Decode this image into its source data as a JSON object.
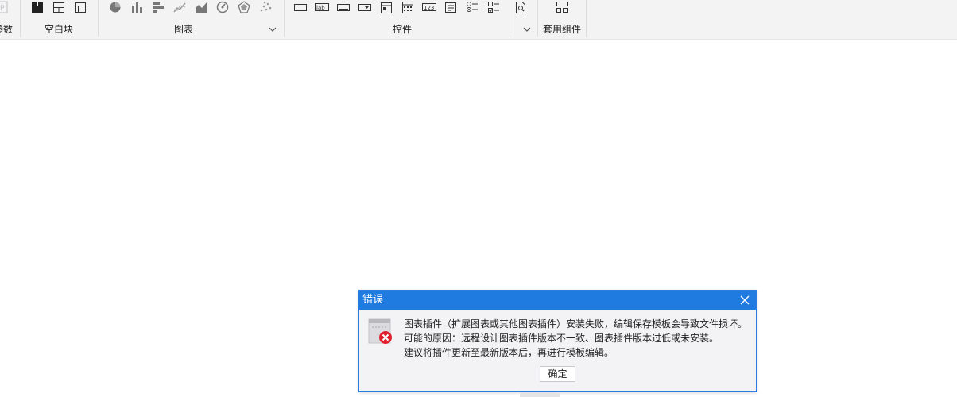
{
  "ribbon": {
    "groups": {
      "params": {
        "label": "参数"
      },
      "blank": {
        "label": "空白块",
        "icons": [
          "block-dark-icon",
          "block-split-icon",
          "block-grid-icon"
        ]
      },
      "chart": {
        "label": "图表",
        "icons": [
          "pie-chart-icon",
          "bar-chart-icon",
          "hbar-chart-icon",
          "line-chart-icon",
          "area-chart-icon",
          "gauge-chart-icon",
          "radar-chart-icon",
          "scatter-chart-icon"
        ]
      },
      "widget": {
        "label": "控件",
        "icons": [
          "textbox-icon",
          "label-icon",
          "button-icon",
          "combo-icon",
          "date-icon",
          "grid-icon",
          "number-icon",
          "list-icon",
          "radio-icon",
          "checkbox-icon",
          "search-doc-icon"
        ]
      },
      "template": {
        "label": "套用组件",
        "icons": [
          "template-icon"
        ]
      }
    }
  },
  "dialog": {
    "title": "错误",
    "lines": [
      "图表插件（扩展图表或其他图表插件）安装失败，编辑保存模板会导致文件损坏。",
      "可能的原因：远程设计图表插件版本不一致、图表插件版本过低或未安装。",
      "建议将插件更新至最新版本后，再进行模板编辑。"
    ],
    "ok_label": "确定",
    "colors": {
      "title_bar": "#1f7be0",
      "error": "#e0202d"
    }
  }
}
